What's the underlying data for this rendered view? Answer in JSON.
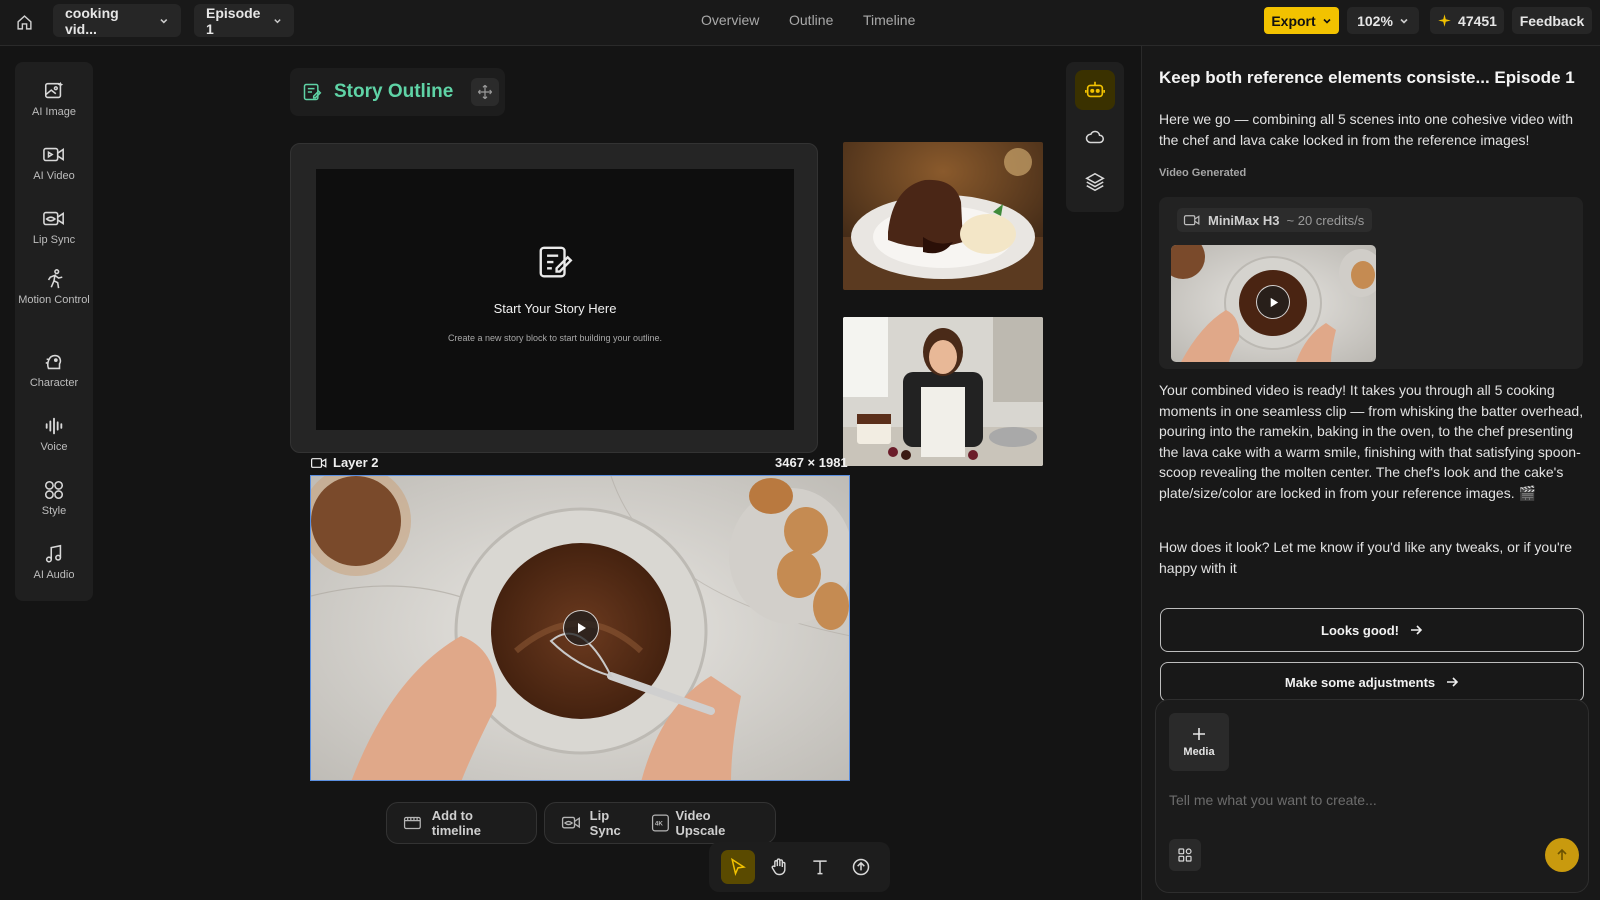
{
  "topbar": {
    "project_name": "cooking vid...",
    "episode": "Episode 1",
    "nav": [
      "Overview",
      "Outline",
      "Timeline"
    ],
    "export_label": "Export",
    "zoom": "102%",
    "credits": "47451",
    "feedback_label": "Feedback"
  },
  "tools": [
    {
      "label": "AI Image",
      "icon": "ai-image-icon"
    },
    {
      "label": "AI Video",
      "icon": "ai-video-icon"
    },
    {
      "label": "Lip Sync",
      "icon": "lip-sync-icon"
    },
    {
      "label": "Motion Control",
      "icon": "motion-control-icon"
    },
    {
      "label": "Character",
      "icon": "character-icon"
    },
    {
      "label": "Voice",
      "icon": "voice-icon"
    },
    {
      "label": "Style",
      "icon": "style-icon"
    },
    {
      "label": "AI Audio",
      "icon": "ai-audio-icon"
    }
  ],
  "canvas": {
    "outline_title": "Story Outline",
    "story_heading": "Start Your Story Here",
    "story_sub": "Create a new story block to start building your outline.",
    "layer_name": "Layer 2",
    "layer_dims": "3467 × 1981",
    "actions": {
      "add_timeline": "Add to timeline",
      "lip_sync": "Lip Sync",
      "video_upscale": "Video Upscale"
    }
  },
  "chat": {
    "title": "Keep both reference elements consiste... Episode 1",
    "intro": "Here we go — combining all 5 scenes into one cohesive video with the chef and lava cake locked in from the reference images!",
    "gen_label": "Video Generated",
    "model": "MiniMax H3",
    "model_credits": "~ 20 credits/s",
    "result": "Your combined video is ready! It takes you through all 5 cooking moments in one seamless clip — from whisking the batter overhead, pouring into the ramekin, baking in the oven, to the chef presenting the lava cake with a warm smile, finishing with that satisfying spoon-scoop revealing the molten center. The chef's look and the cake's plate/size/color are locked in from your reference images. 🎬",
    "question": "How does it look? Let me know if you'd like any tweaks, or if you're happy with it",
    "reply_good": "Looks good!",
    "reply_adjust": "Make some adjustments",
    "media_label": "Media",
    "input_placeholder": "Tell me what you want to create..."
  },
  "colors": {
    "accent": "#f2c200",
    "outline_green": "#5fd3a6",
    "selection_blue": "#5b8fe0"
  }
}
